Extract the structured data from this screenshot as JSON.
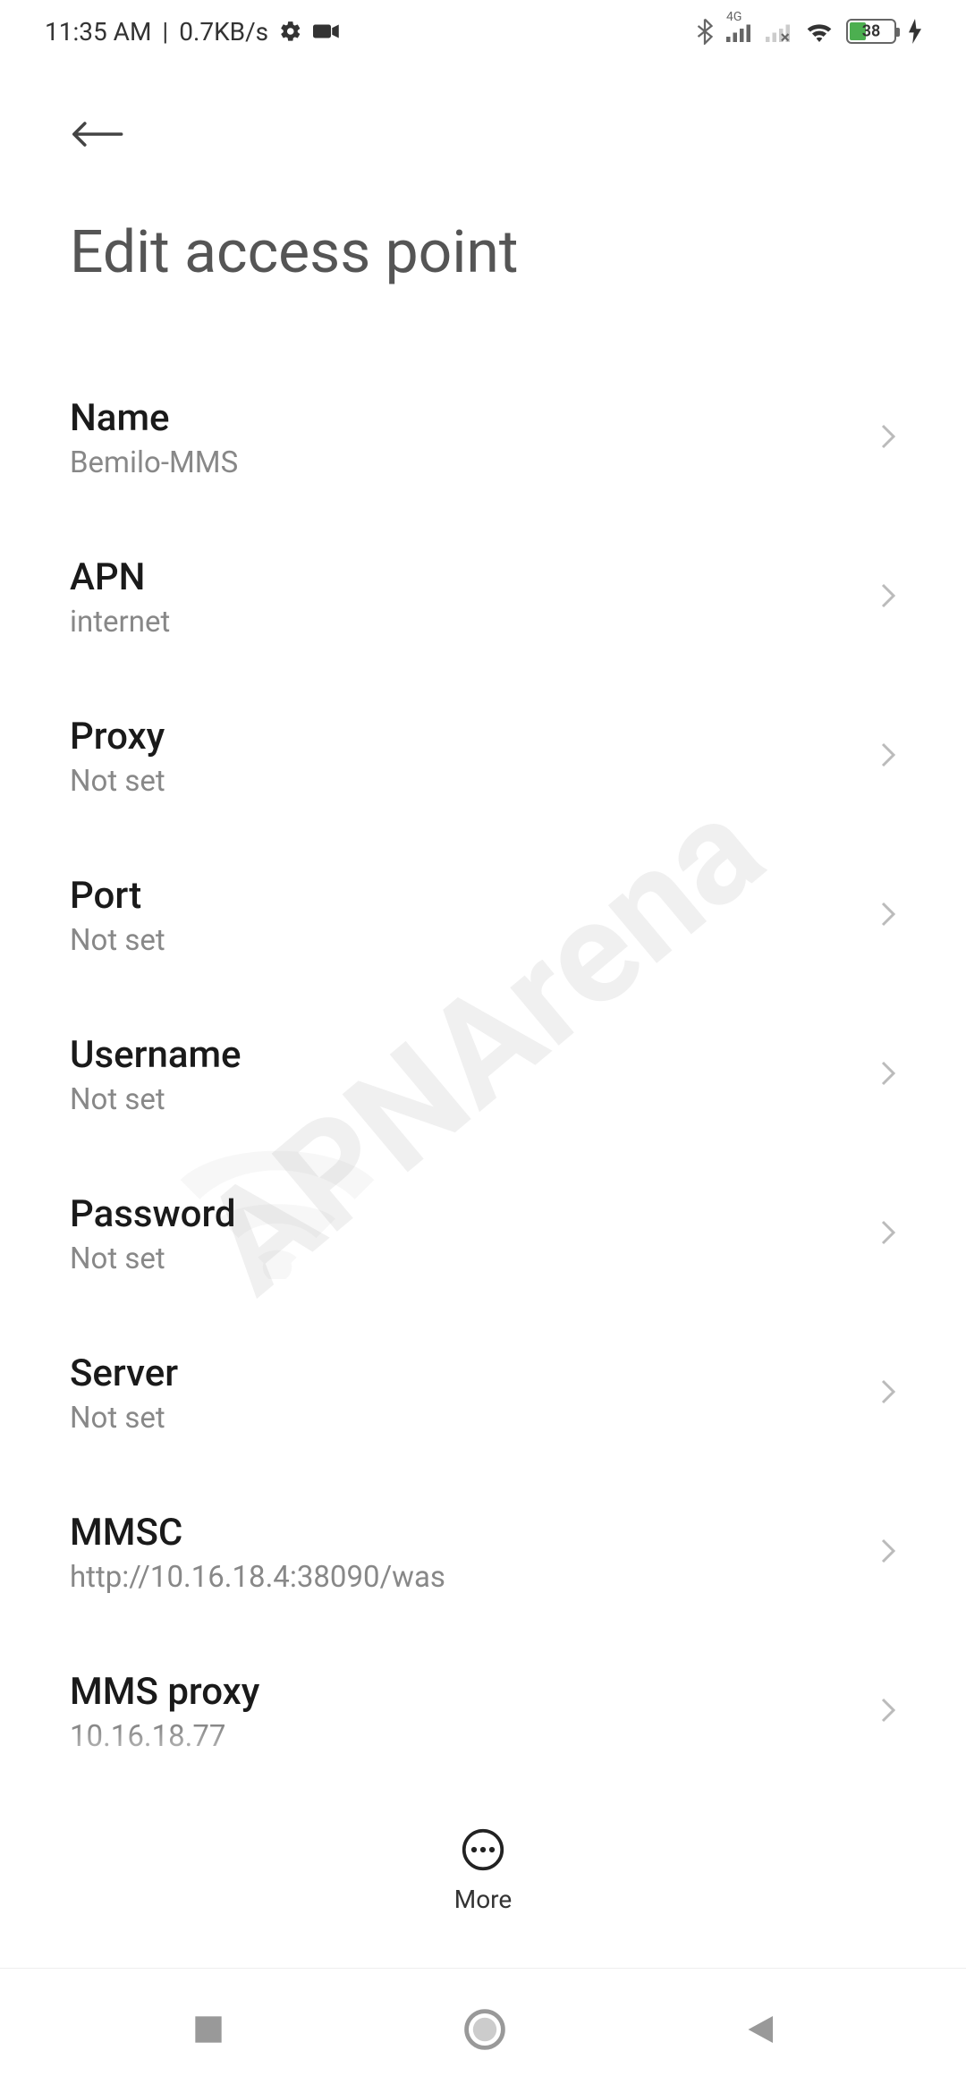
{
  "status": {
    "time": "11:35 AM",
    "speed": "0.7KB/s",
    "network_label": "4G",
    "battery_pct": "38"
  },
  "page": {
    "title": "Edit access point"
  },
  "settings": [
    {
      "label": "Name",
      "value": "Bemilo-MMS"
    },
    {
      "label": "APN",
      "value": "internet"
    },
    {
      "label": "Proxy",
      "value": "Not set"
    },
    {
      "label": "Port",
      "value": "Not set"
    },
    {
      "label": "Username",
      "value": "Not set"
    },
    {
      "label": "Password",
      "value": "Not set"
    },
    {
      "label": "Server",
      "value": "Not set"
    },
    {
      "label": "MMSC",
      "value": "http://10.16.18.4:38090/was"
    },
    {
      "label": "MMS proxy",
      "value": "10.16.18.77"
    }
  ],
  "more": {
    "label": "More"
  },
  "watermark": {
    "text": "APNArena"
  }
}
